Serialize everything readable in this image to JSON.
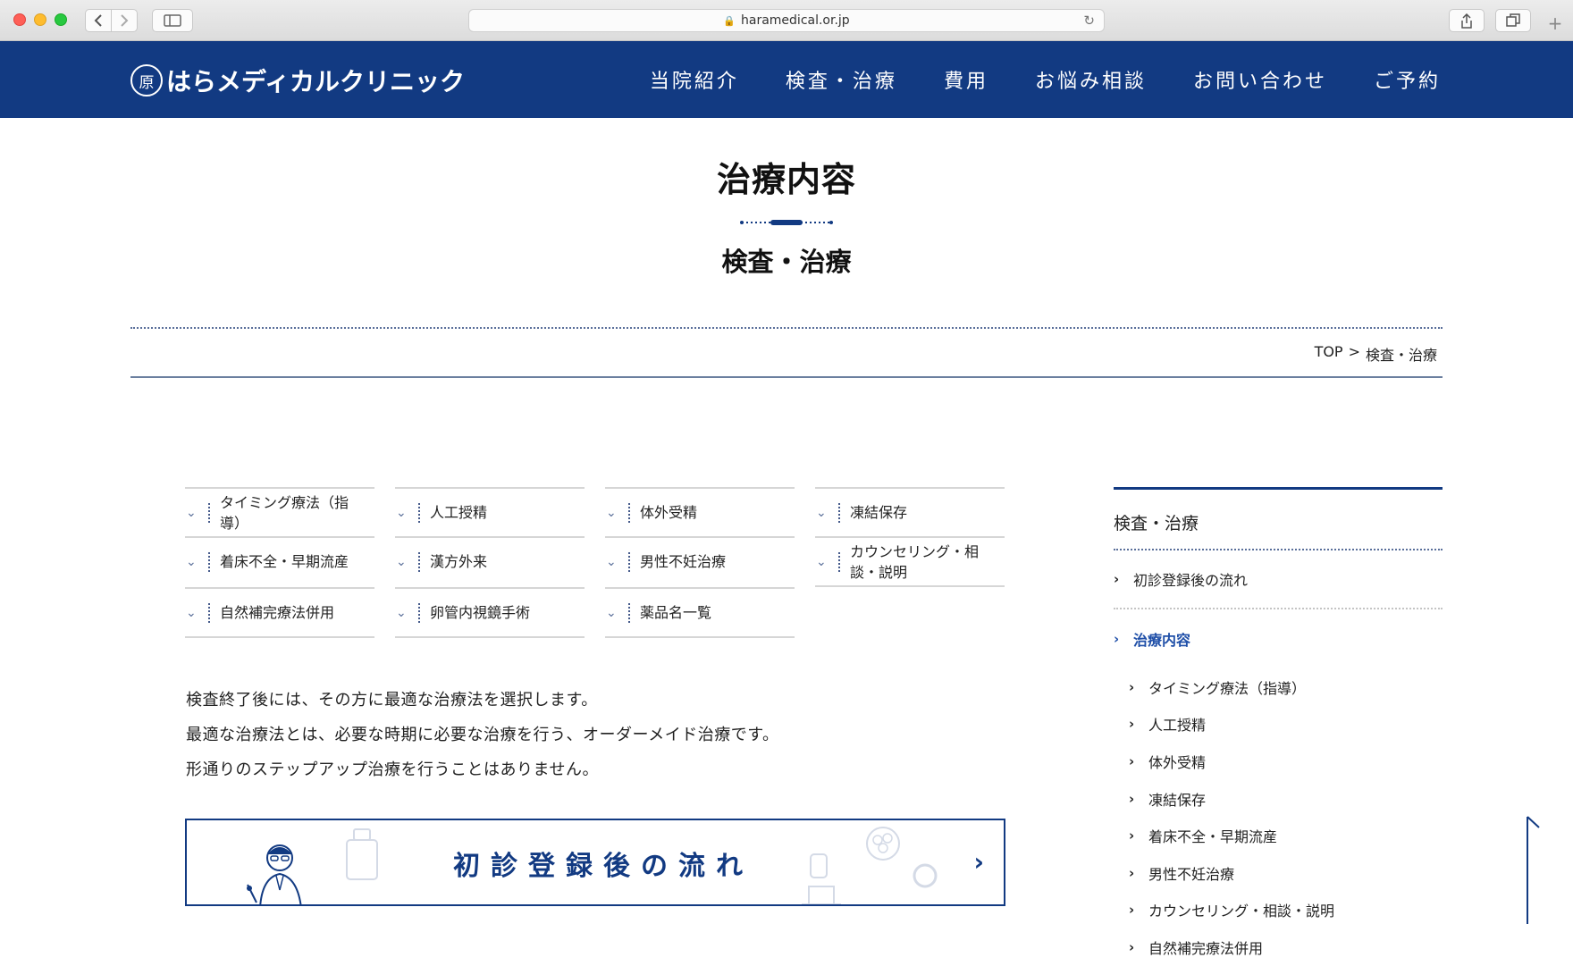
{
  "browser": {
    "url": "haramedical.or.jp",
    "back_icon": "chevron-left-icon",
    "forward_icon": "chevron-right-icon"
  },
  "header": {
    "logo_mark": "原",
    "logo_text": "はらメディカルクリニック",
    "nav": [
      "当院紹介",
      "検査・治療",
      "費用",
      "お悩み相談",
      "お問い合わせ",
      "ご予約"
    ]
  },
  "page": {
    "title": "治療内容",
    "subtitle": "検査・治療"
  },
  "breadcrumb": {
    "home": "TOP",
    "separator": ">",
    "current": "検査・治療"
  },
  "anchors": [
    "タイミング療法（指導）",
    "人工授精",
    "体外受精",
    "凍結保存",
    "着床不全・早期流産",
    "漢方外来",
    "男性不妊治療",
    "カウンセリング・相談・説明",
    "自然補完療法併用",
    "卵管内視鏡手術",
    "薬品名一覧"
  ],
  "intro": [
    "検査終了後には、その方に最適な治療法を選択します。",
    "最適な治療法とは、必要な時期に必要な治療を行う、オーダーメイド治療です。",
    "形通りのステップアップ治療を行うことはありません。"
  ],
  "banner": {
    "title": "初診登録後の流れ",
    "arrow": "›"
  },
  "sidebar": {
    "heading": "検査・治療",
    "links": [
      "初診登録後の流れ",
      "治療内容"
    ],
    "sub_links": [
      "タイミング療法（指導）",
      "人工授精",
      "体外受精",
      "凍結保存",
      "着床不全・早期流産",
      "男性不妊治療",
      "カウンセリング・相談・説明",
      "自然補完療法併用"
    ]
  },
  "colors": {
    "brand_navy": "#123a82",
    "active_link": "#1f4fa8"
  }
}
